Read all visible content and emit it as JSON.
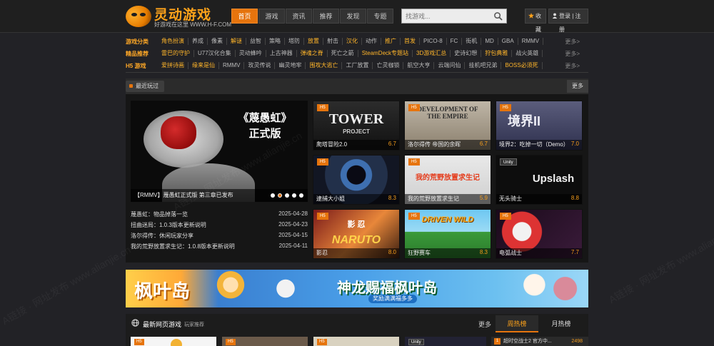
{
  "brand": {
    "title": "灵动游戏",
    "subtitle": "好游戏在这里 WWW.H-F.COM"
  },
  "nav": [
    "首页",
    "游戏",
    "资讯",
    "推荐",
    "发现",
    "专题"
  ],
  "search": {
    "placeholder": "找游戏..."
  },
  "top_buttons": {
    "favorite": "收藏",
    "login": "登录 | 注册"
  },
  "categories": [
    {
      "label": "游戏分类",
      "items": [
        "角色扮演",
        "养成",
        "像素",
        "解谜",
        "益智",
        "策略",
        "塔防",
        "放置",
        "射击",
        "汉化",
        "动作",
        "推广",
        "首发",
        "PICO-8",
        "FC",
        "街机",
        "MD",
        "GBA",
        "RMMV"
      ],
      "more": "更多>"
    },
    {
      "label": "精品推荐",
      "items": [
        "雷巴的守护",
        "U77汉化合集",
        "灵动蜂吟",
        "上古神器",
        "弹魂之脊",
        "死亡之箭",
        "SteamDeck专题站",
        "3D游戏汇总",
        "史诗幻想",
        "狩包典雅",
        "战火英雄"
      ],
      "more": "更多>"
    },
    {
      "label": "H5 游戏",
      "items": [
        "爱拼诗画",
        "缘来是仙",
        "RMMV",
        "玫灵传说",
        "幽灵地牢",
        "围攻大逃亡",
        "工厂放置",
        "亡灵枷锁",
        "航空大亨",
        "云端问仙",
        "挂机吧兄弟",
        "BOSS必须死"
      ],
      "more": "更多>"
    }
  ],
  "recent": {
    "tag": "最近玩过",
    "more": "更多"
  },
  "hero": {
    "title_line1": "《蔑愚虹》",
    "title_line2": "正式版",
    "caption": "【RMMV】蔑愚虹正式版 第三章已发布"
  },
  "news": [
    {
      "title": "蔑愚虹：物品掉落一览",
      "date": "2025-04-28"
    },
    {
      "title": "扭曲迷局：1.0.3版本更新说明",
      "date": "2025-04-23"
    },
    {
      "title": "洛尔得传：休闲玩家分享",
      "date": "2025-04-15"
    },
    {
      "title": "我的荒野放置求生记：1.0.8版本更新说明",
      "date": "2025-04-11"
    }
  ],
  "tiles": [
    {
      "badge": "H5",
      "name": "爬塔冒险2.0",
      "score": "6.7",
      "art": "TOWER",
      "art_sub": "PROJECT"
    },
    {
      "badge": "H5",
      "name": "洛尔得传 帝国的余晖",
      "score": "6.7",
      "art": "DEVELOPMENT OF THE EMPIRE",
      "art_sub": ""
    },
    {
      "badge": "H5",
      "name": "境界2：吃掉一切（Demo）",
      "score": "7.0",
      "art": "境界II",
      "art_sub": ""
    },
    {
      "badge": "H5",
      "name": "逮捕大小姐",
      "score": "8.3",
      "art": "",
      "art_sub": ""
    },
    {
      "badge": "H5",
      "name": "我的荒野放置求生记",
      "score": "5.9",
      "art": "我的荒野放置求生记",
      "art_sub": ""
    },
    {
      "badge": "Unity",
      "name": "无头骑士",
      "score": "8.8",
      "art": "Upslash",
      "art_sub": ""
    },
    {
      "badge": "H5",
      "name": "影忍",
      "score": "8.0",
      "art": "NARUTO",
      "art_sub": "影 忍"
    },
    {
      "badge": "H5",
      "name": "狂野赛车",
      "score": "8.3",
      "art": "DRIVEN WILD",
      "art_sub": ""
    },
    {
      "badge": "H5",
      "name": "电弧战士",
      "score": "7.7",
      "art": "",
      "art_sub": ""
    }
  ],
  "banner": {
    "left": "枫叶岛",
    "mid": "神龙赐福枫叶岛",
    "sub": "奖励满满福多多"
  },
  "bottom": {
    "title": "最新网页游戏",
    "subtitle": "玩家推荐",
    "more": "更多",
    "tab1": "周热榜",
    "tab2": "月热榜",
    "rank1_num": "1",
    "rank1_name": "超时空战士2 官方中...",
    "rank1_val": "2498"
  },
  "watermark": "A链接 · 网址发布 www.alianjie.cn",
  "colors": {
    "accent": "#e6740d",
    "brand": "#ffa31a",
    "score": "#f39c1c"
  }
}
